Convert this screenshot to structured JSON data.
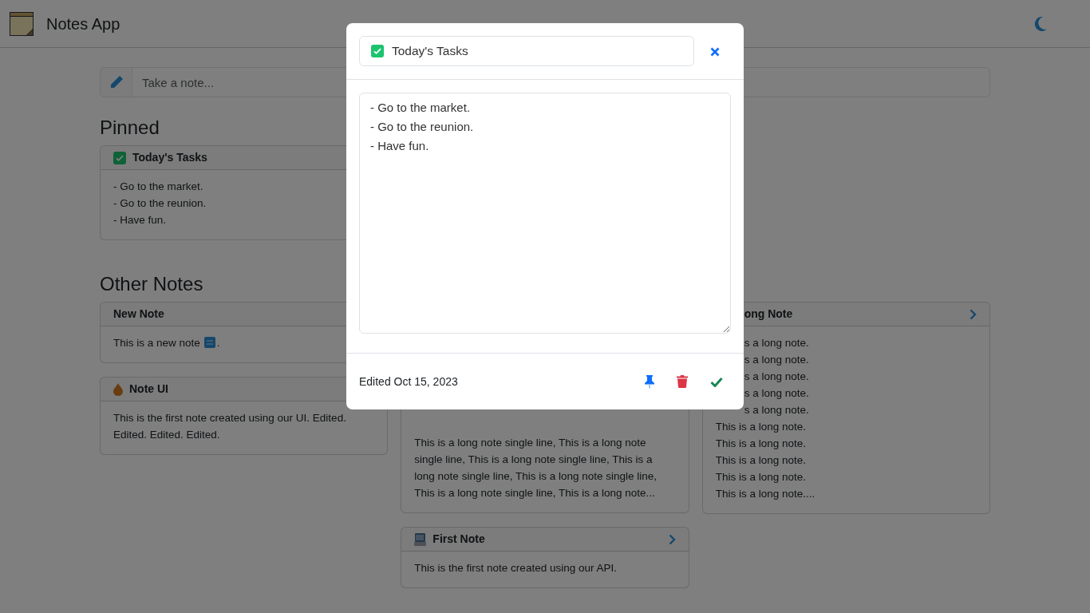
{
  "app": {
    "title": "Notes App"
  },
  "composer": {
    "placeholder": "Take a note..."
  },
  "sections": [
    {
      "heading": "Pinned",
      "columns": [
        [
          {
            "title": "Today's Tasks",
            "lines": [
              "- Go to the market.",
              "- Go to the reunion.",
              "- Have fun."
            ]
          }
        ]
      ]
    },
    {
      "heading": "Other Notes",
      "columns": [
        [
          {
            "title": "New Note",
            "lines": [
              "This is a new note"
            ],
            "new_badge": true,
            "line_end": "."
          },
          {
            "title": "Note UI",
            "paragraph": "This is the first note created using our UI. Edited. Edited. Edited. Edited."
          }
        ],
        [
          {
            "lines": [
              "This is a long note single line, This is a long note",
              "single line, This is a long note single line, This is a",
              "long note single line, This is a long note single line,",
              "This is a long note single line, This is a long note..."
            ]
          },
          {
            "title": "First Note",
            "lines": [
              "This is the first note created using our API."
            ],
            "chevron": true
          }
        ],
        [
          {
            "title_clipped": "ong Note",
            "clipped_lines": [
              "s a long note.",
              "s a long note.",
              "s a long note.",
              "s a long note.",
              "s a long note."
            ],
            "lines": [
              "This is a long note.",
              "This is a long note.",
              "This is a long note.",
              "This is a long note.",
              "This is a long note...."
            ],
            "chevron": true
          }
        ]
      ]
    }
  ],
  "editor": {
    "title": "Today's Tasks",
    "body": "- Go to the market.\n- Go to the reunion.\n- Have fun.",
    "edited": "Edited Oct 15, 2023"
  }
}
